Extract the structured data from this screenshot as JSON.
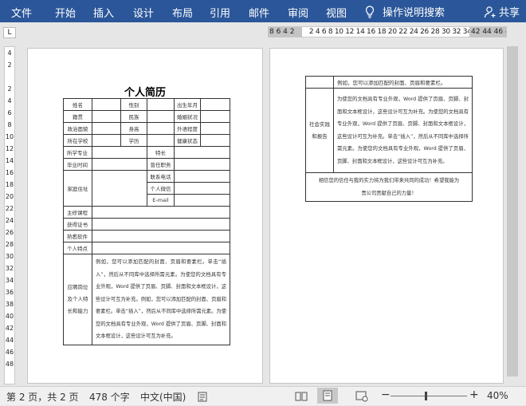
{
  "ribbon": {
    "tabs": [
      "文件",
      "开始",
      "插入",
      "设计",
      "布局",
      "引用",
      "邮件",
      "审阅",
      "视图"
    ],
    "tell_me": "操作说明搜索",
    "share": "共享"
  },
  "ruler": {
    "corner": "L",
    "h_left": "8 6 4 2",
    "h_main": "2  4  6  8 10 12 14 16 18 20 22 24 26 28 30 32 34 36 38",
    "h_right": "42 44 46 48",
    "v_marks": [
      "4",
      "2",
      "",
      "2",
      "4",
      "6",
      "8",
      "10",
      "12",
      "14",
      "16",
      "18",
      "20",
      "22",
      "24",
      "26",
      "28",
      "30",
      "32",
      "34",
      "36",
      "38",
      "40",
      "42",
      "44",
      "46",
      "48"
    ]
  },
  "page1": {
    "title": "个人简历",
    "rows": {
      "name": "姓名",
      "gender": "性别",
      "birth": "出生年月",
      "ethnic": "籍贯",
      "nation": "民族",
      "marriage": "婚姻状况",
      "politics": "政治面貌",
      "height": "身高",
      "language": "外语程度",
      "hukou": "所在学校",
      "education": "学历",
      "health": "健康状态",
      "major": "所学专业",
      "specialty": "特长",
      "grad": "毕业时间",
      "position": "曾任职务",
      "address": "家庭住址",
      "phone": "联系电话",
      "wechat": "个人微信",
      "email": "E-mail",
      "courses": "主修课程",
      "certs": "获得证书",
      "software": "熟悉软件",
      "traits": "个人特点",
      "apply": "应聘岗位及个人特长和能力",
      "apply_text": "例如，您可以添加匹配的封面、页眉和要素栏。单击“插入”，然后从不同库中选择所需元素。为使您的文档具有专业外观，Word 提供了页眉、页脚、封面和文本框设计，这些设计可互为补充。例如，您可以添加匹配的封面、页眉和要素栏。单击“插入”，然后从不同库中选择所需元素。为使您的文档具有专业外观，Word 提供了页眉、页脚、封面和文本框设计，这些设计可互为补充。"
    }
  },
  "page2": {
    "top_text": "例如，您可以添加匹配的封面、页眉和要素栏。",
    "label": "社会实践和报告",
    "body_text": "为使您的文档具有专业外观，Word 提供了页眉、页脚、封面和文本框设计，这些设计可互为补充。为使您的文档具有专业外观，Word 提供了页眉、页脚、封面和文本框设计，这些设计可互为补充。单击“插入”，然后从不同库中选择所需元素。为使您的文档具有专业外观，Word 提供了页眉、页脚、封面和文本框设计，这些设计可互为补充。",
    "footer_text": "相信您的信任与我的实力将为我们带来共同的成功！希望我能为贵公司贡献自己的力量！"
  },
  "status": {
    "page": "第 2 页，共 2 页",
    "words": "478 个字",
    "lang": "中文(中国)",
    "zoom": "40%",
    "minus": "−",
    "plus": "+"
  }
}
